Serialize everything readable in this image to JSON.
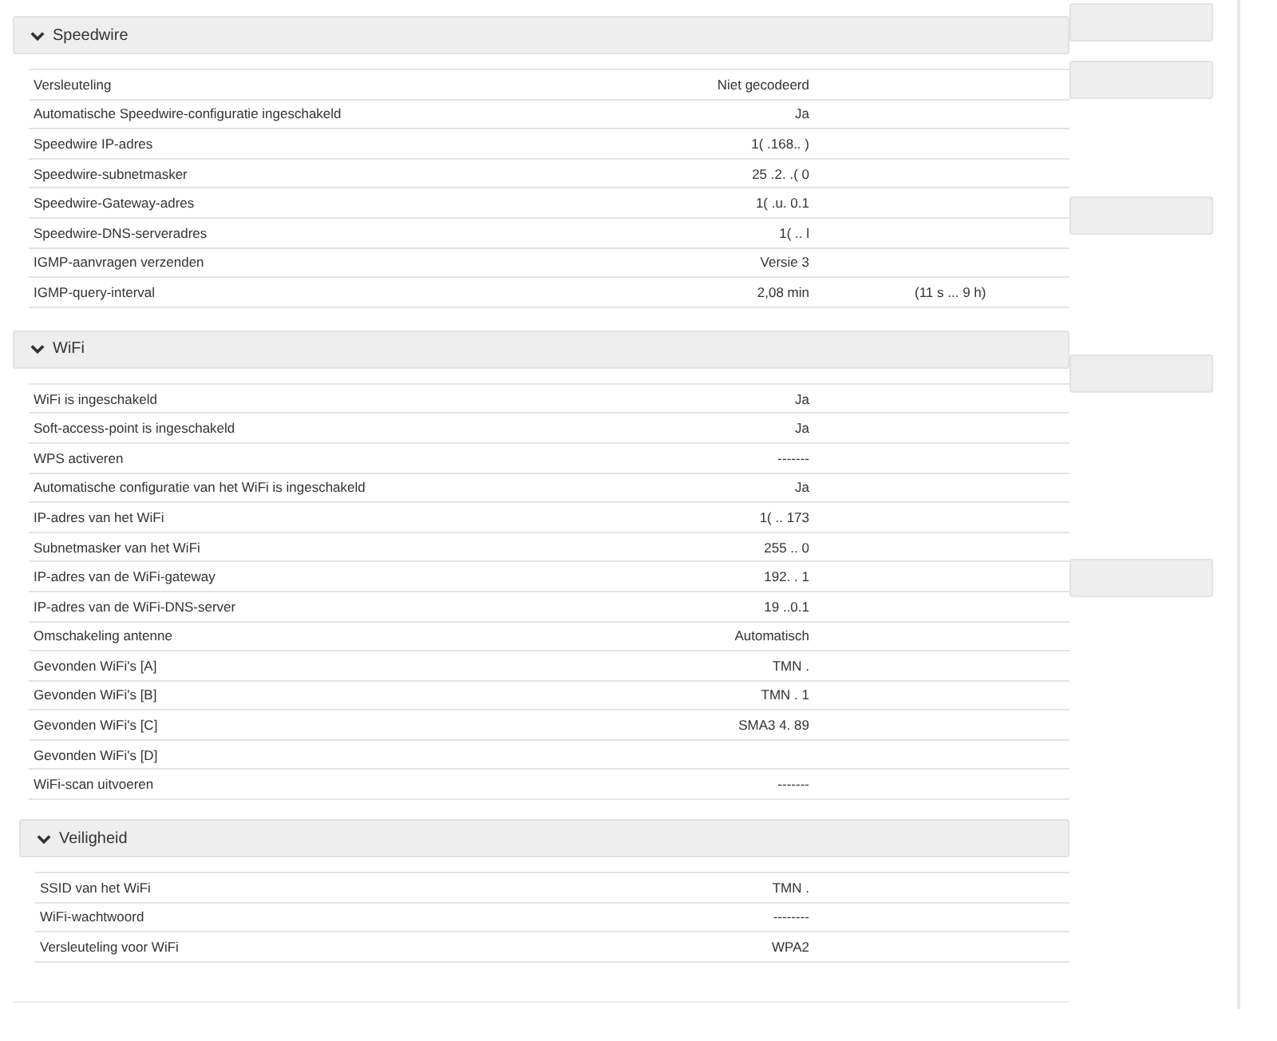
{
  "sections": [
    {
      "title": "Speedwire",
      "expanded": true,
      "rows": [
        {
          "label": "Versleuteling",
          "value": "Niet gecodeerd"
        },
        {
          "label": "Automatische Speedwire-configuratie ingeschakeld",
          "value": "Ja"
        },
        {
          "label": "Speedwire IP-adres",
          "value": "1( .168.. )"
        },
        {
          "label": "Speedwire-subnetmasker",
          "value": "25 .2. .( 0"
        },
        {
          "label": "Speedwire-Gateway-adres",
          "value": "1( .u. 0.1"
        },
        {
          "label": "Speedwire-DNS-serveradres",
          "value": "1( .. l"
        },
        {
          "label": "IGMP-aanvragen verzenden",
          "value": "Versie 3"
        },
        {
          "label": "IGMP-query-interval",
          "value": "2,08 min",
          "range": "(11 s ... 9 h)"
        }
      ]
    },
    {
      "title": "WiFi",
      "expanded": true,
      "rows": [
        {
          "label": "WiFi is ingeschakeld",
          "value": "Ja"
        },
        {
          "label": "Soft-access-point is ingeschakeld",
          "value": "Ja"
        },
        {
          "label": "WPS activeren",
          "value": "-------"
        },
        {
          "label": "Automatische configuratie van het WiFi is ingeschakeld",
          "value": "Ja"
        },
        {
          "label": "IP-adres van het WiFi",
          "value": "1( .. 173"
        },
        {
          "label": "Subnetmasker van het WiFi",
          "value": "255 .. 0"
        },
        {
          "label": "IP-adres van de WiFi-gateway",
          "value": "192. . 1"
        },
        {
          "label": "IP-adres van de WiFi-DNS-server",
          "value": "19 ..0.1"
        },
        {
          "label": "Omschakeling antenne",
          "value": "Automatisch"
        },
        {
          "label": "Gevonden WiFi's [A]",
          "value": "TMN ."
        },
        {
          "label": "Gevonden WiFi's [B]",
          "value": "TMN . 1"
        },
        {
          "label": "Gevonden WiFi's [C]",
          "value": "SMA3 4. 89"
        },
        {
          "label": "Gevonden WiFi's [D]"
        },
        {
          "label": "WiFi-scan uitvoeren",
          "value": "-------"
        }
      ],
      "subsections": [
        {
          "title": "Veiligheid",
          "expanded": true,
          "rows": [
            {
              "label": "SSID van het WiFi",
              "value": "TMN  ."
            },
            {
              "label": "WiFi-wachtwoord",
              "value": "--------"
            },
            {
              "label": "Versleuteling voor WiFi",
              "value": "WPA2"
            }
          ]
        }
      ]
    }
  ]
}
